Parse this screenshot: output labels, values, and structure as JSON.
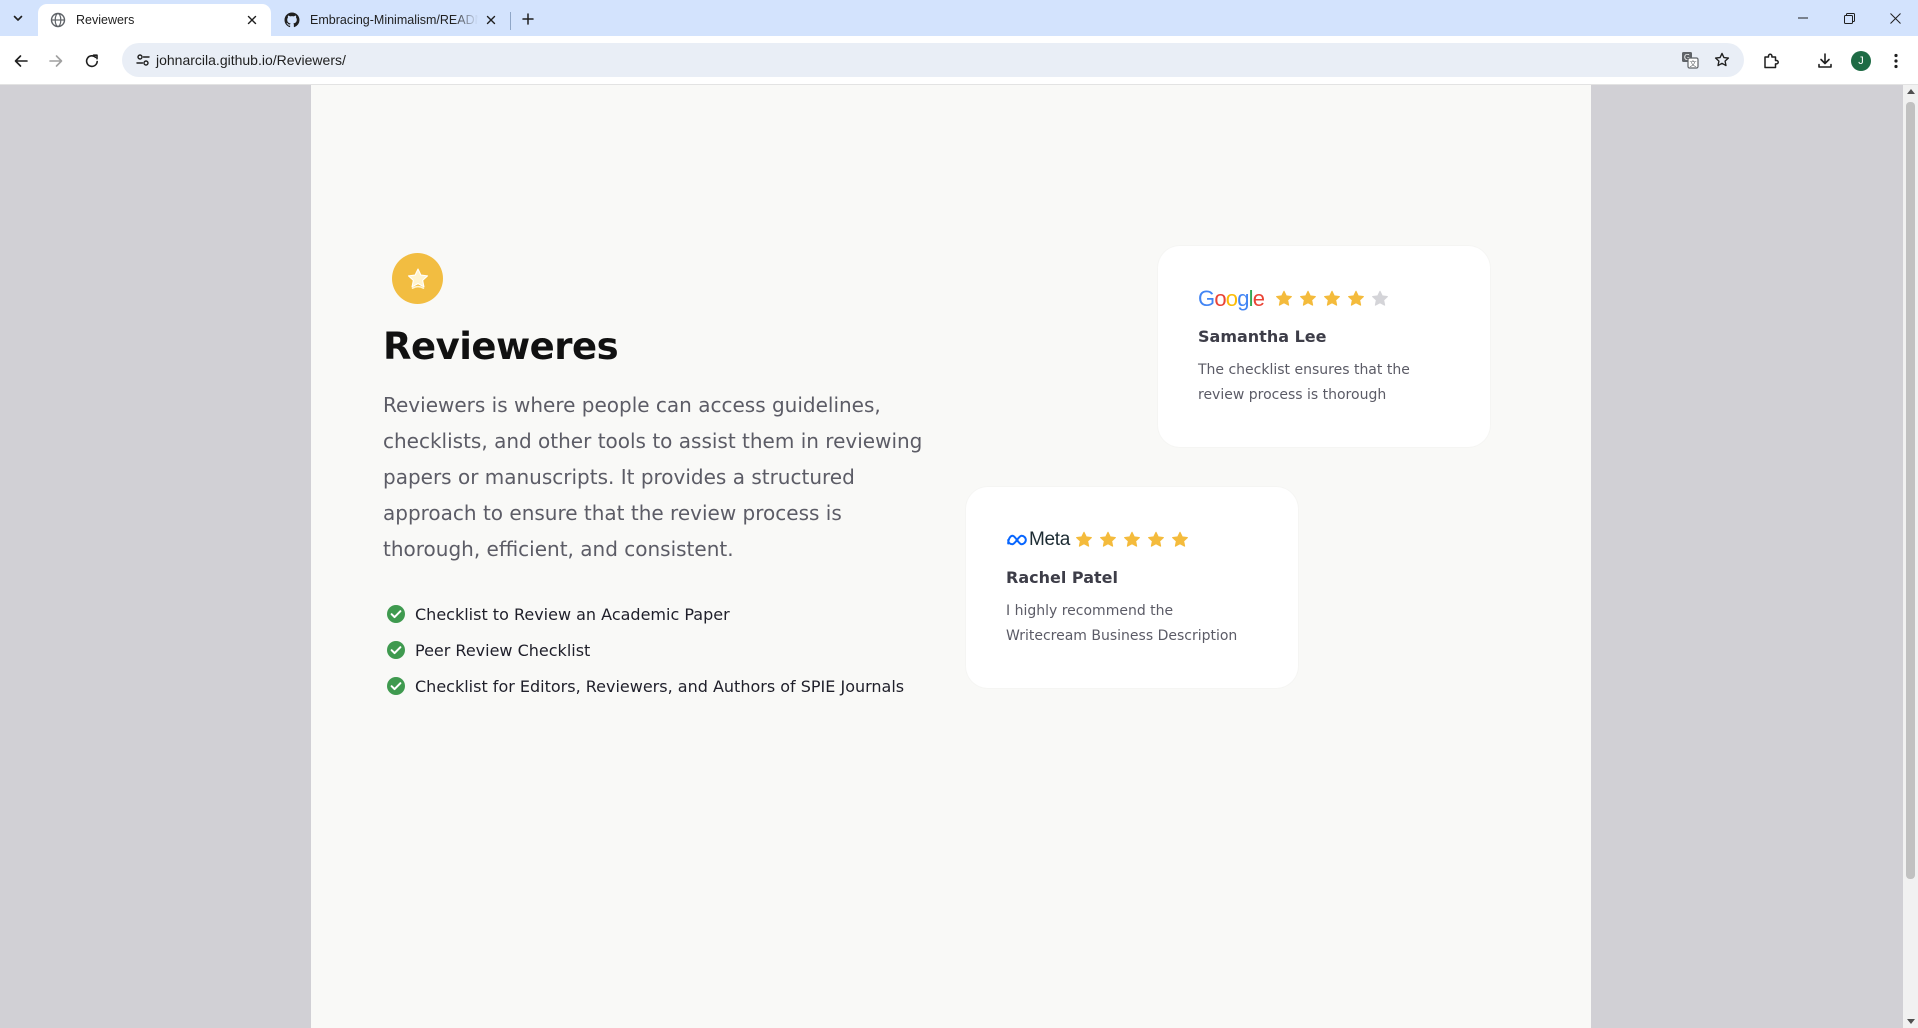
{
  "browser": {
    "tabs": [
      {
        "title": "Reviewers",
        "active": true,
        "favicon": "globe-icon"
      },
      {
        "title": "Embracing-Minimalism/READM",
        "active": false,
        "favicon": "github-icon"
      }
    ],
    "url": "johnarcila.github.io/Reviewers/",
    "profile_initial": "J"
  },
  "hero": {
    "icon": "star-badge-icon",
    "title": "Revieweres",
    "description": "Reviewers is where people can access guidelines, checklists, and other tools to assist them in reviewing papers or manuscripts. It provides a structured approach to ensure that the review process is thorough, efficient, and consistent.",
    "checklist": [
      "Checklist to Review an Academic Paper",
      "Peer Review Checklist",
      "Checklist for Editors, Reviewers, and Authors of SPIE Journals"
    ]
  },
  "reviews": [
    {
      "brand": "Google",
      "rating": 4,
      "max_rating": 5,
      "name": "Samantha Lee",
      "text": "The checklist ensures that the review process is thorough"
    },
    {
      "brand": "Meta",
      "rating": 5,
      "max_rating": 5,
      "name": "Rachel Patel",
      "text": "I highly recommend the Writecream Business Description"
    }
  ],
  "colors": {
    "accent_yellow": "#f2bd41",
    "check_green": "#3f9a4f",
    "star_filled": "#f4bb3c",
    "star_empty": "#d4d4d8",
    "page_bg": "#f9f9f7",
    "outer_bg": "#d1d0d5"
  }
}
